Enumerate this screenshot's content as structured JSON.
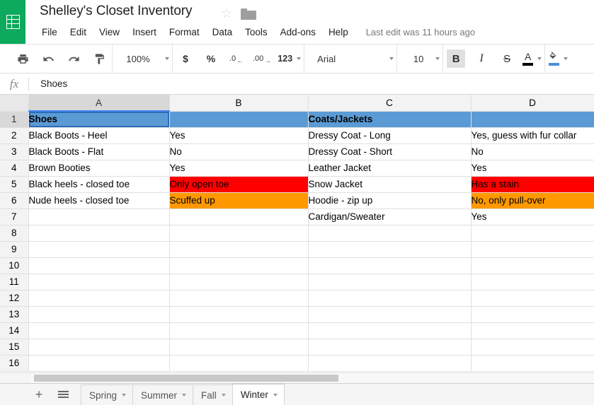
{
  "app": {
    "logo_icon": "sheets-grid-icon",
    "brand_green": "#0da95d"
  },
  "header": {
    "doc_title": "Shelley's Closet Inventory",
    "star_icon": "star-outline-icon",
    "folder_icon": "folder-icon",
    "last_edit": "Last edit was 11 hours ago",
    "menu": [
      {
        "label": "File"
      },
      {
        "label": "Edit"
      },
      {
        "label": "View"
      },
      {
        "label": "Insert"
      },
      {
        "label": "Format"
      },
      {
        "label": "Data"
      },
      {
        "label": "Tools"
      },
      {
        "label": "Add-ons"
      },
      {
        "label": "Help"
      }
    ]
  },
  "toolbar": {
    "print_icon": "print-icon",
    "undo_icon": "undo-icon",
    "redo_icon": "redo-icon",
    "paint_format_icon": "paint-format-icon",
    "zoom_value": "100%",
    "currency_label": "$",
    "percent_label": "%",
    "decimal_decrease_label": ".0",
    "decimal_increase_label": ".00",
    "number_format_label": "123",
    "font_value": "Arial",
    "font_size_value": "10",
    "bold_label": "B",
    "italic_label": "I",
    "strikethrough_label": "S",
    "text_color_label": "A",
    "text_color_value": "#000000",
    "fill_color_icon": "fill-color-icon",
    "fill_color_value": "#4a90d9"
  },
  "formula_bar": {
    "fx_label": "fx",
    "value": "Shoes"
  },
  "grid": {
    "columns": [
      "A",
      "B",
      "C",
      "D"
    ],
    "selected_column": "A",
    "selected_row": "1",
    "active_cell": "A1",
    "row_numbers": [
      "1",
      "2",
      "3",
      "4",
      "5",
      "6",
      "7",
      "8",
      "9",
      "10",
      "11",
      "12",
      "13",
      "14",
      "15",
      "16"
    ],
    "rows": [
      {
        "num": "1",
        "selected": true,
        "cells": [
          {
            "text": "Shoes",
            "bold": true,
            "active": true
          },
          {
            "text": ""
          },
          {
            "text": "Coats/Jackets",
            "bold": true
          },
          {
            "text": ""
          }
        ]
      },
      {
        "num": "2",
        "cells": [
          {
            "text": "Black Boots - Heel"
          },
          {
            "text": "Yes"
          },
          {
            "text": "Dressy Coat - Long"
          },
          {
            "text": "Yes, guess with fur collar"
          }
        ]
      },
      {
        "num": "3",
        "cells": [
          {
            "text": "Black Boots - Flat"
          },
          {
            "text": "No"
          },
          {
            "text": "Dressy Coat - Short"
          },
          {
            "text": "No"
          }
        ]
      },
      {
        "num": "4",
        "cells": [
          {
            "text": "Brown Booties"
          },
          {
            "text": "Yes"
          },
          {
            "text": "Leather Jacket"
          },
          {
            "text": "Yes"
          }
        ]
      },
      {
        "num": "5",
        "cells": [
          {
            "text": "Black heels - closed toe"
          },
          {
            "text": "Only open toe",
            "fill": "red"
          },
          {
            "text": "Snow Jacket"
          },
          {
            "text": "Has a stain",
            "fill": "red"
          }
        ]
      },
      {
        "num": "6",
        "cells": [
          {
            "text": "Nude heels - closed toe"
          },
          {
            "text": "Scuffed up",
            "fill": "orange"
          },
          {
            "text": "Hoodie - zip up"
          },
          {
            "text": "No, only pull-over",
            "fill": "orange"
          }
        ]
      },
      {
        "num": "7",
        "cells": [
          {
            "text": ""
          },
          {
            "text": ""
          },
          {
            "text": "Cardigan/Sweater"
          },
          {
            "text": "Yes"
          }
        ]
      },
      {
        "num": "8",
        "cells": [
          {
            "text": ""
          },
          {
            "text": ""
          },
          {
            "text": ""
          },
          {
            "text": ""
          }
        ]
      },
      {
        "num": "9",
        "cells": [
          {
            "text": ""
          },
          {
            "text": ""
          },
          {
            "text": ""
          },
          {
            "text": ""
          }
        ]
      },
      {
        "num": "10",
        "cells": [
          {
            "text": ""
          },
          {
            "text": ""
          },
          {
            "text": ""
          },
          {
            "text": ""
          }
        ]
      },
      {
        "num": "11",
        "cells": [
          {
            "text": ""
          },
          {
            "text": ""
          },
          {
            "text": ""
          },
          {
            "text": ""
          }
        ]
      },
      {
        "num": "12",
        "cells": [
          {
            "text": ""
          },
          {
            "text": ""
          },
          {
            "text": ""
          },
          {
            "text": ""
          }
        ]
      },
      {
        "num": "13",
        "cells": [
          {
            "text": ""
          },
          {
            "text": ""
          },
          {
            "text": ""
          },
          {
            "text": ""
          }
        ]
      },
      {
        "num": "14",
        "cells": [
          {
            "text": ""
          },
          {
            "text": ""
          },
          {
            "text": ""
          },
          {
            "text": ""
          }
        ]
      },
      {
        "num": "15",
        "cells": [
          {
            "text": ""
          },
          {
            "text": ""
          },
          {
            "text": ""
          },
          {
            "text": ""
          }
        ]
      },
      {
        "num": "16",
        "cells": [
          {
            "text": ""
          },
          {
            "text": ""
          },
          {
            "text": ""
          },
          {
            "text": ""
          }
        ]
      }
    ],
    "fill_colors": {
      "red": "#ff0000",
      "orange": "#ff9900",
      "row_selection": "#5b9bd5"
    }
  },
  "bottom": {
    "add_sheet_label": "+",
    "all_sheets_icon": "hamburger-icon",
    "tabs": [
      {
        "label": "Spring",
        "active": false
      },
      {
        "label": "Summer",
        "active": false
      },
      {
        "label": "Fall",
        "active": false
      },
      {
        "label": "Winter",
        "active": true
      }
    ]
  }
}
